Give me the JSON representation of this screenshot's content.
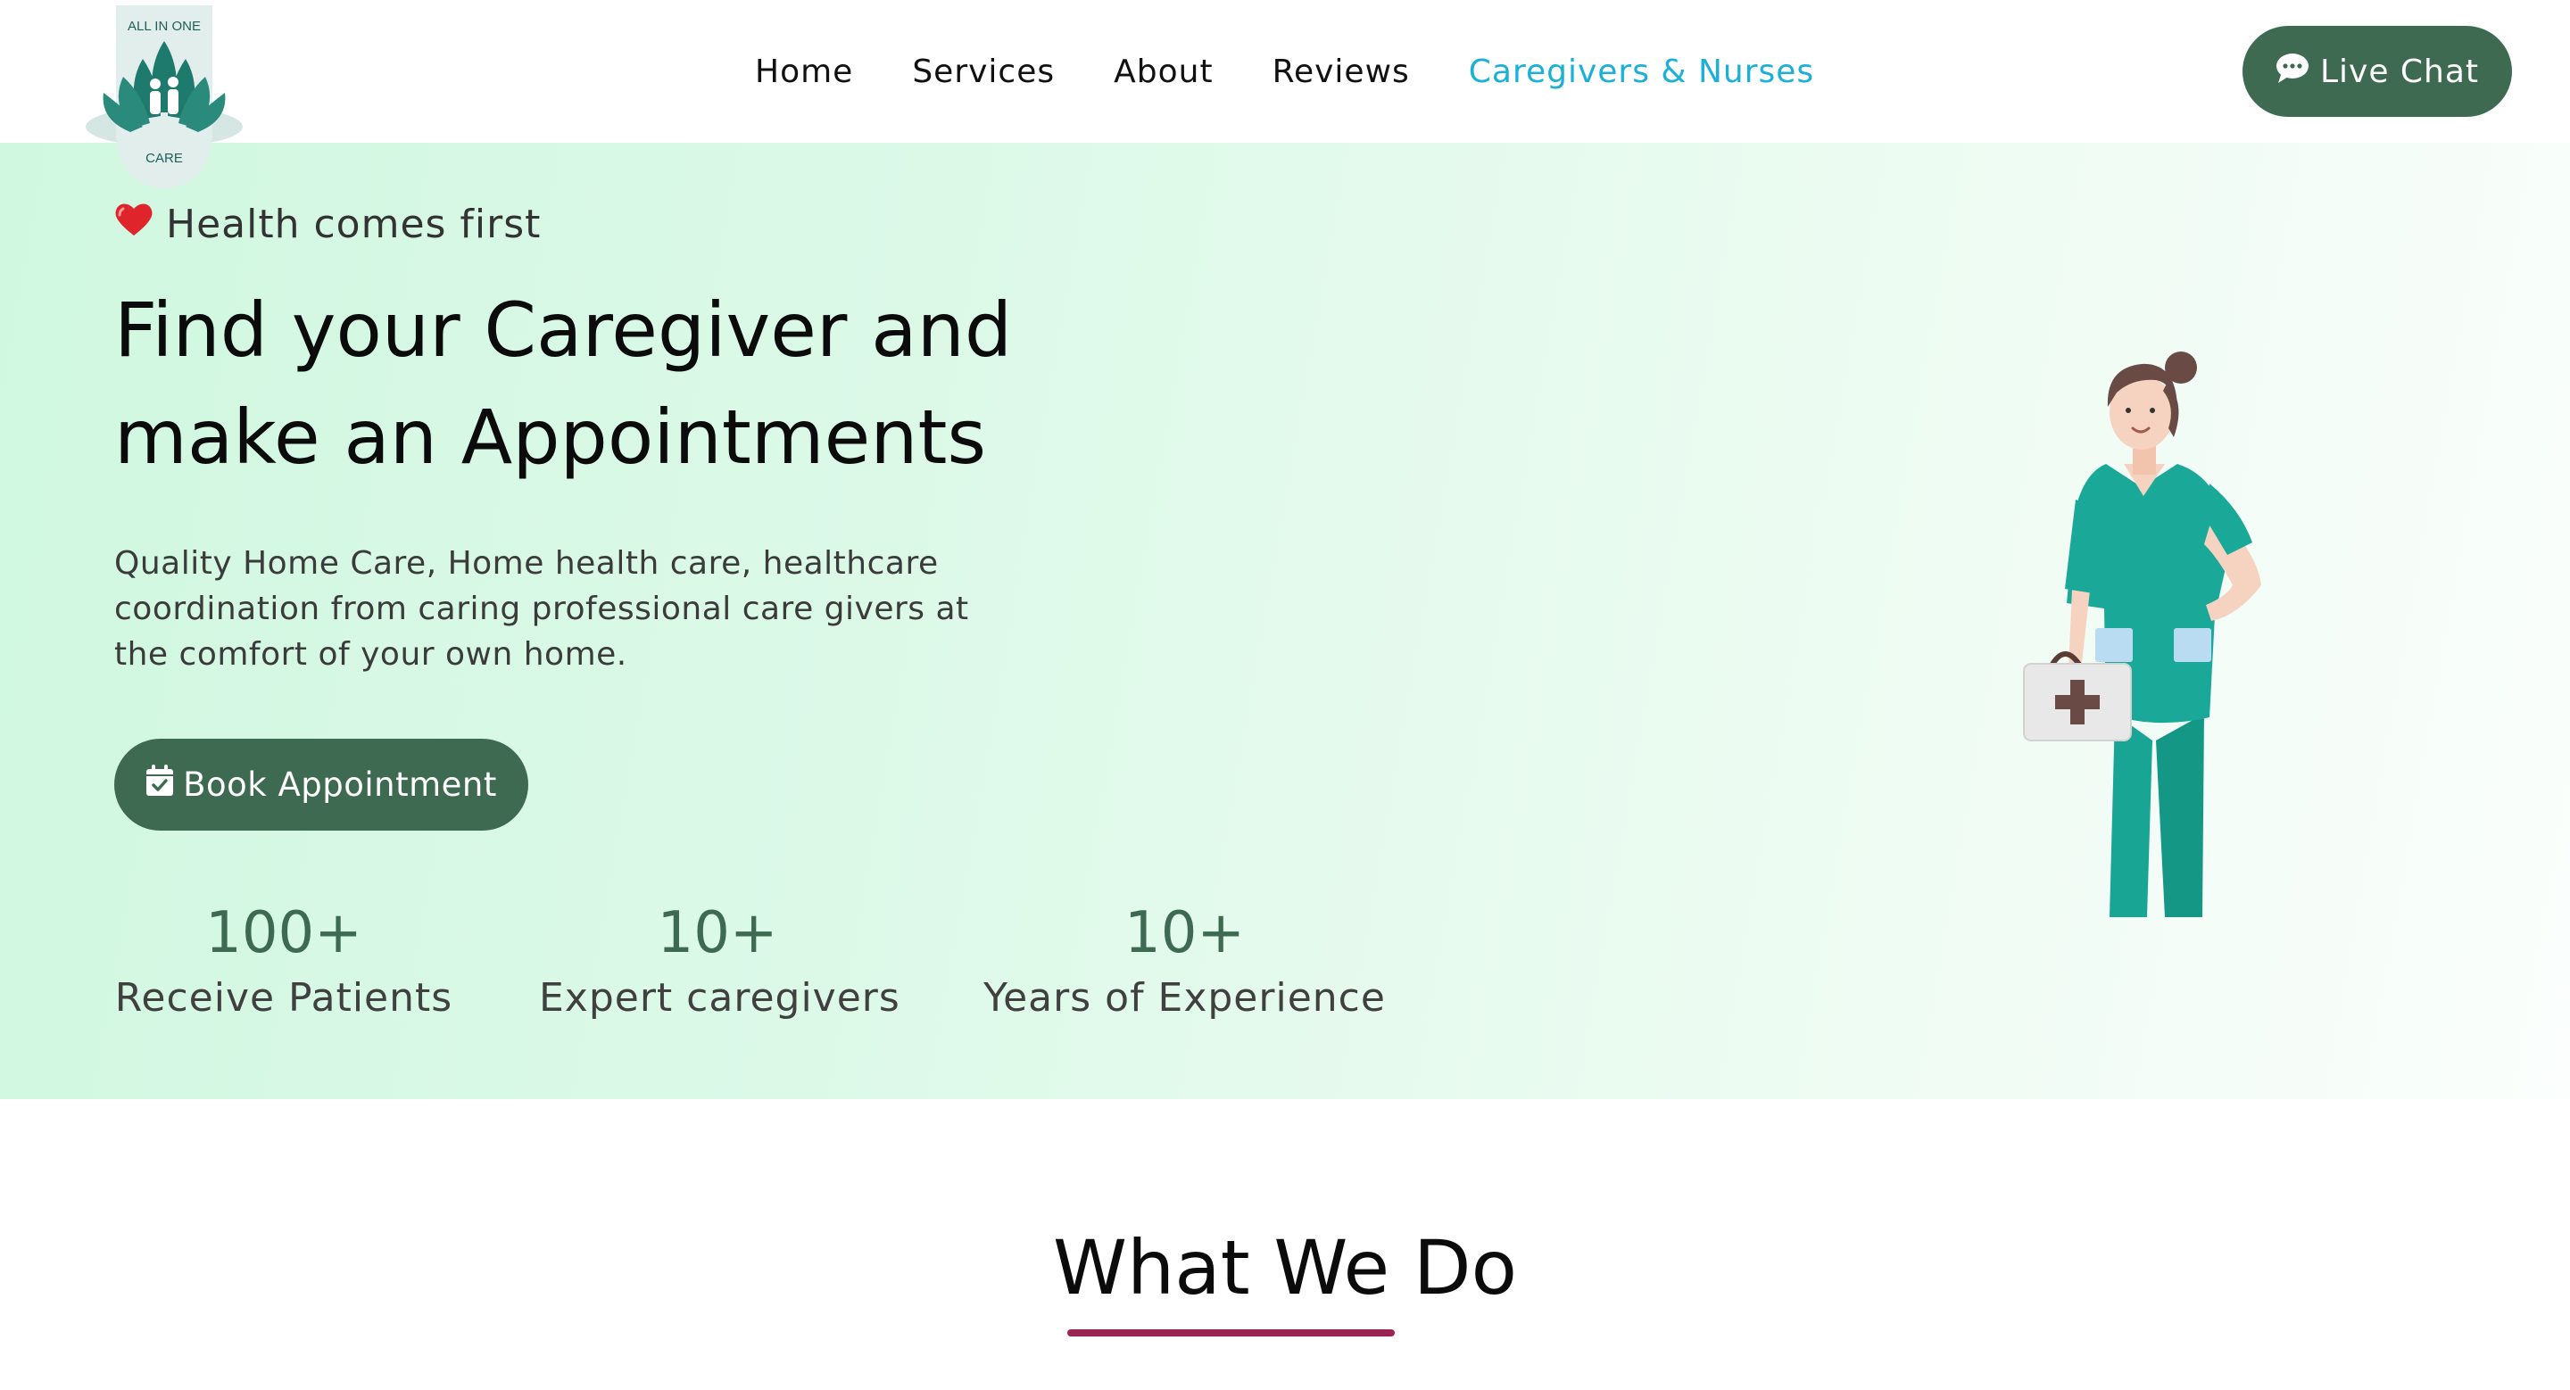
{
  "logo": {
    "top_text": "ALL IN ONE",
    "bottom_text": "CARE"
  },
  "nav": {
    "items": [
      {
        "label": "Home",
        "active": false
      },
      {
        "label": "Services",
        "active": false
      },
      {
        "label": "About",
        "active": false
      },
      {
        "label": "Reviews",
        "active": false
      },
      {
        "label": "Caregivers & Nurses",
        "active": true
      }
    ],
    "active_color": "#1bb0d6"
  },
  "live_chat": {
    "label": "Live Chat",
    "icon": "chat-bubble-icon"
  },
  "hero": {
    "tagline": "Health comes first",
    "tagline_icon": "heart-icon",
    "title_line1": "Find your Caregiver and",
    "title_line2": "make an Appointments",
    "description": "Quality Home Care, Home health care, healthcare coordination from caring professional care givers at the comfort of your own home.",
    "book_button": {
      "label": "Book Appointment",
      "icon": "calendar-check-icon"
    },
    "illustration": "nurse-illustration",
    "stats": [
      {
        "value": "100+",
        "label": "Receive Patients"
      },
      {
        "value": "10+",
        "label": "Expert caregivers"
      },
      {
        "value": "10+",
        "label": "Years of Experience"
      }
    ]
  },
  "section": {
    "title": "What We Do"
  },
  "colors": {
    "brand_green": "#3e6a51",
    "accent_blue": "#1bb0d6",
    "underline": "#9c2454"
  }
}
